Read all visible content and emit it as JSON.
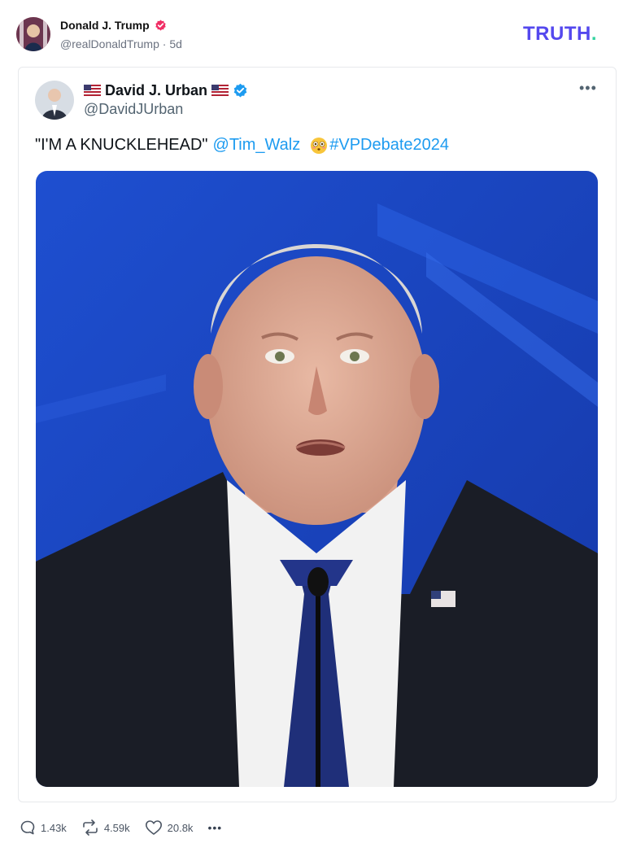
{
  "post": {
    "author_name": "Donald J. Trump",
    "handle": "@realDonaldTrump",
    "separator": "·",
    "age": "5d",
    "logo": {
      "text": "TRUTH",
      "dot": "."
    }
  },
  "embed": {
    "name": "David J. Urban",
    "handle": "@DavidJUrban",
    "more": "•••",
    "text_quote": "\"I'M A KNUCKLEHEAD\"",
    "mention": "@Tim_Walz",
    "emoji": "flushed-face",
    "hashtag": "#VPDebate2024"
  },
  "actions": {
    "replies": "1.43k",
    "retruths": "4.59k",
    "likes": "20.8k",
    "more": "•••"
  },
  "colors": {
    "brand": "#5448ee",
    "brand_dot": "#35d3a0",
    "verified_truth": "#f02d64",
    "verified_x": "#1d9bf0",
    "link": "#1d9bf0"
  },
  "icons": [
    "verified-badge-icon",
    "us-flag-icon",
    "verified-check-icon",
    "more-icon",
    "reply-icon",
    "retruth-icon",
    "like-icon",
    "flushed-emoji-icon"
  ]
}
